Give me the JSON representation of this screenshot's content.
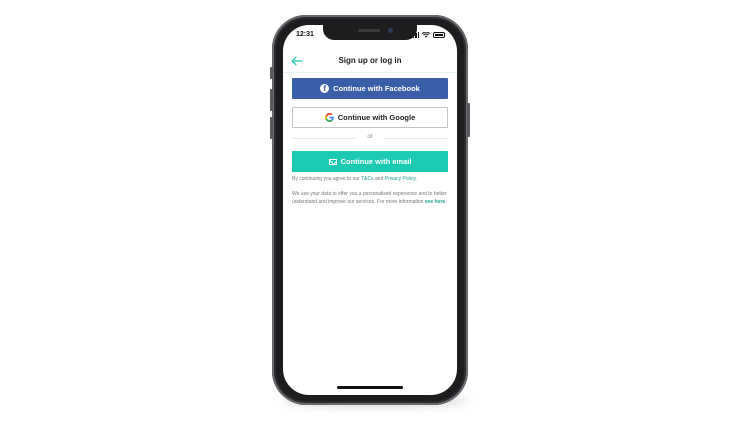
{
  "status_bar": {
    "time": "12:31",
    "icons": [
      "cellular-signal-icon",
      "wifi-icon",
      "battery-icon"
    ]
  },
  "nav": {
    "back_icon": "arrow-left-icon",
    "title": "Sign up or log in"
  },
  "buttons": {
    "facebook": {
      "label": "Continue with Facebook",
      "icon": "facebook-icon"
    },
    "google": {
      "label": "Continue with Google",
      "icon": "google-icon"
    },
    "email": {
      "label": "Continue with email",
      "icon": "mail-icon"
    }
  },
  "divider_text": "or",
  "terms": {
    "prefix": "By continuing you agree to our ",
    "tcs_link": "T&Cs",
    "and": " and ",
    "privacy_link": "Privacy Policy",
    "suffix": "."
  },
  "info": {
    "text": "We use your data to offer you a personalised experience and to better understand and improve our services. For more information ",
    "link": "see here",
    "suffix": "."
  },
  "colors": {
    "facebook": "#3b5ea8",
    "accent": "#1ccab3",
    "link": "#1aa48f",
    "frame": "#1d1d1f"
  }
}
